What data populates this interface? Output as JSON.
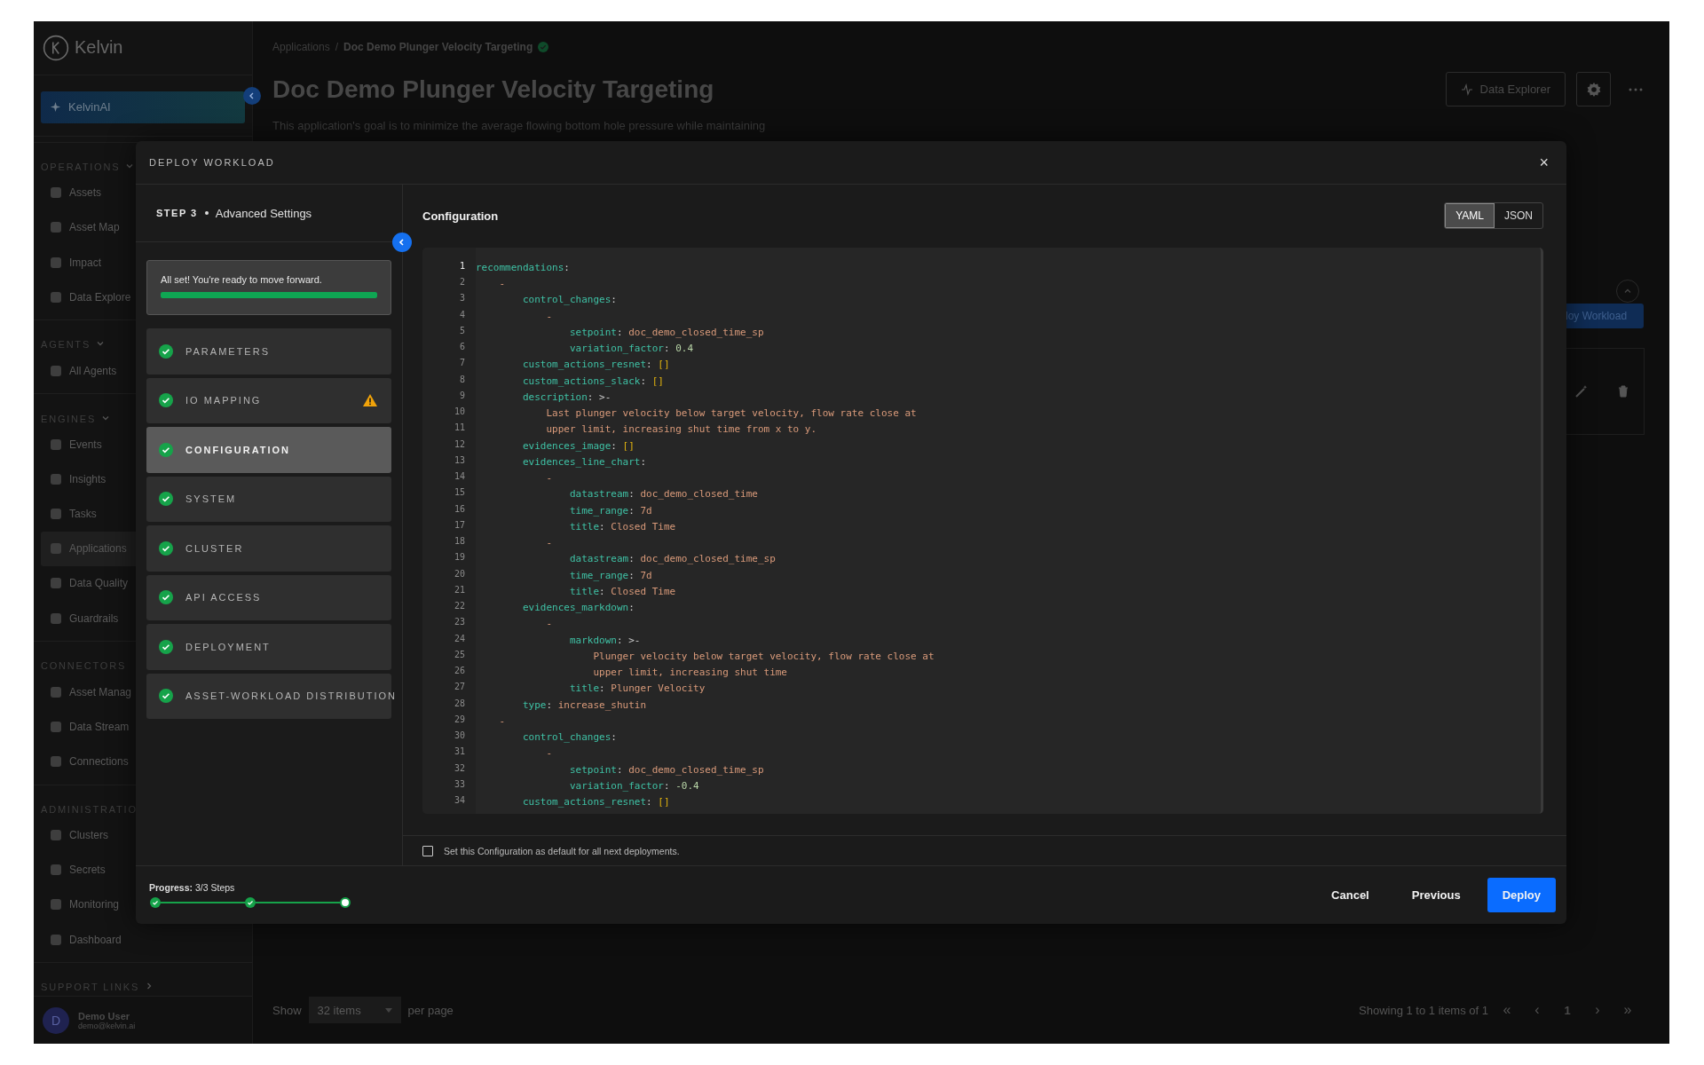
{
  "sidebar": {
    "logo": "Kelvin",
    "ai_button": "KelvinAI",
    "sections": [
      {
        "title": "OPERATIONS",
        "collapsible": true,
        "expanded": true,
        "items": [
          {
            "label": "Assets",
            "selected": false
          },
          {
            "label": "Asset Map",
            "selected": false
          },
          {
            "label": "Impact",
            "selected": false
          },
          {
            "label": "Data Explore",
            "selected": false
          }
        ]
      },
      {
        "title": "AGENTS",
        "collapsible": true,
        "expanded": true,
        "items": [
          {
            "label": "All Agents",
            "selected": false
          }
        ]
      },
      {
        "title": "ENGINES",
        "collapsible": true,
        "expanded": true,
        "items": [
          {
            "label": "Events",
            "selected": false
          },
          {
            "label": "Insights",
            "selected": false
          },
          {
            "label": "Tasks",
            "selected": false
          },
          {
            "label": "Applications",
            "selected": true
          },
          {
            "label": "Data Quality",
            "selected": false
          },
          {
            "label": "Guardrails",
            "selected": false
          }
        ]
      },
      {
        "title": "CONNECTORS",
        "collapsible": false,
        "items": [
          {
            "label": "Asset Manag",
            "selected": false
          },
          {
            "label": "Data Stream",
            "selected": false
          },
          {
            "label": "Connections",
            "selected": false
          }
        ]
      },
      {
        "title": "ADMINISTRATIO",
        "collapsible": false,
        "items": [
          {
            "label": "Clusters",
            "selected": false
          },
          {
            "label": "Secrets",
            "selected": false
          },
          {
            "label": "Monitoring",
            "selected": false
          },
          {
            "label": "Dashboard",
            "selected": false
          }
        ]
      },
      {
        "title": "SUPPORT LINKS",
        "collapsible": true,
        "expanded": false
      }
    ],
    "user": {
      "initial": "D",
      "name": "Demo User",
      "email": "demo@kelvin.ai"
    }
  },
  "page": {
    "breadcrumb": [
      "Applications",
      "Doc Demo Plunger Velocity Targeting"
    ],
    "breadcrumb_separator": "/",
    "title": "Doc Demo Plunger Velocity Targeting",
    "description": "This application's goal is to minimize the average flowing bottom hole pressure while maintaining",
    "data_explorer": "Data Explorer",
    "workload_button": "loy Workload",
    "pagination": {
      "show": "Show",
      "page_size": "32 items",
      "per_page": "per page",
      "summary": "Showing 1 to 1 items of 1",
      "first": "«",
      "prev": "‹",
      "page": "1",
      "next": "›",
      "last": "»"
    }
  },
  "modal": {
    "title": "DEPLOY WORKLOAD",
    "close": "×",
    "step": "STEP 3",
    "step_name": "Advanced Settings",
    "ready": {
      "text": "All set! You're ready to move forward.",
      "level": 1
    },
    "steps": [
      {
        "label": "PARAMETERS",
        "done": true,
        "warning": false,
        "selected": false
      },
      {
        "label": "IO MAPPING",
        "done": true,
        "warning": true,
        "selected": false
      },
      {
        "label": "CONFIGURATION",
        "done": true,
        "warning": false,
        "selected": true
      },
      {
        "label": "SYSTEM",
        "done": true,
        "warning": false,
        "selected": false
      },
      {
        "label": "CLUSTER",
        "done": true,
        "warning": false,
        "selected": false
      },
      {
        "label": "API ACCESS",
        "done": true,
        "warning": false,
        "selected": false
      },
      {
        "label": "DEPLOYMENT",
        "done": true,
        "warning": false,
        "selected": false
      },
      {
        "label": "ASSET-WORKLOAD DISTRIBUTION",
        "done": true,
        "warning": false,
        "selected": false
      }
    ],
    "config_title": "Configuration",
    "formats": [
      {
        "label": "YAML",
        "selected": true
      },
      {
        "label": "JSON",
        "selected": false
      }
    ],
    "code": [
      {
        "n": "1",
        "current": true,
        "tokens": [
          {
            "kind": "key",
            "text": "recommendations"
          },
          {
            "kind": "punct",
            "text": ":"
          }
        ]
      },
      {
        "n": "2",
        "current": false,
        "tokens": [
          {
            "kind": "dash",
            "text": "    -"
          }
        ]
      },
      {
        "n": "3",
        "current": false,
        "tokens": [
          {
            "kind": "key",
            "text": "        control_changes"
          },
          {
            "kind": "punct",
            "text": ":"
          }
        ]
      },
      {
        "n": "4",
        "current": false,
        "tokens": [
          {
            "kind": "dash",
            "text": "            -"
          }
        ]
      },
      {
        "n": "5",
        "current": false,
        "tokens": [
          {
            "kind": "key",
            "text": "                setpoint"
          },
          {
            "kind": "punct",
            "text": ": "
          },
          {
            "kind": "str",
            "text": "doc_demo_closed_time_sp"
          }
        ]
      },
      {
        "n": "6",
        "current": false,
        "tokens": [
          {
            "kind": "key",
            "text": "                variation_factor"
          },
          {
            "kind": "punct",
            "text": ": "
          },
          {
            "kind": "num",
            "text": "0.4"
          }
        ]
      },
      {
        "n": "7",
        "current": false,
        "tokens": [
          {
            "kind": "key",
            "text": "        custom_actions_resnet"
          },
          {
            "kind": "punct",
            "text": ": "
          },
          {
            "kind": "bracket",
            "text": "[]"
          }
        ]
      },
      {
        "n": "8",
        "current": false,
        "tokens": [
          {
            "kind": "key",
            "text": "        custom_actions_slack"
          },
          {
            "kind": "punct",
            "text": ": "
          },
          {
            "kind": "bracket",
            "text": "[]"
          }
        ]
      },
      {
        "n": "9",
        "current": false,
        "tokens": [
          {
            "kind": "key",
            "text": "        description"
          },
          {
            "kind": "punct",
            "text": ": >-"
          }
        ]
      },
      {
        "n": "10",
        "current": false,
        "tokens": [
          {
            "kind": "str",
            "text": "            Last plunger velocity below target velocity, flow rate close at"
          }
        ]
      },
      {
        "n": "11",
        "current": false,
        "tokens": [
          {
            "kind": "str",
            "text": "            upper limit, increasing shut time from x to y."
          }
        ]
      },
      {
        "n": "12",
        "current": false,
        "tokens": [
          {
            "kind": "key",
            "text": "        evidences_image"
          },
          {
            "kind": "punct",
            "text": ": "
          },
          {
            "kind": "bracket",
            "text": "[]"
          }
        ]
      },
      {
        "n": "13",
        "current": false,
        "tokens": [
          {
            "kind": "key",
            "text": "        evidences_line_chart"
          },
          {
            "kind": "punct",
            "text": ":"
          }
        ]
      },
      {
        "n": "14",
        "current": false,
        "tokens": [
          {
            "kind": "dash",
            "text": "            -"
          }
        ]
      },
      {
        "n": "15",
        "current": false,
        "tokens": [
          {
            "kind": "key",
            "text": "                datastream"
          },
          {
            "kind": "punct",
            "text": ": "
          },
          {
            "kind": "str",
            "text": "doc_demo_closed_time"
          }
        ]
      },
      {
        "n": "16",
        "current": false,
        "tokens": [
          {
            "kind": "key",
            "text": "                time_range"
          },
          {
            "kind": "punct",
            "text": ": "
          },
          {
            "kind": "str",
            "text": "7d"
          }
        ]
      },
      {
        "n": "17",
        "current": false,
        "tokens": [
          {
            "kind": "key",
            "text": "                title"
          },
          {
            "kind": "punct",
            "text": ": "
          },
          {
            "kind": "str",
            "text": "Closed Time"
          }
        ]
      },
      {
        "n": "18",
        "current": false,
        "tokens": [
          {
            "kind": "dash",
            "text": "            -"
          }
        ]
      },
      {
        "n": "19",
        "current": false,
        "tokens": [
          {
            "kind": "key",
            "text": "                datastream"
          },
          {
            "kind": "punct",
            "text": ": "
          },
          {
            "kind": "str",
            "text": "doc_demo_closed_time_sp"
          }
        ]
      },
      {
        "n": "20",
        "current": false,
        "tokens": [
          {
            "kind": "key",
            "text": "                time_range"
          },
          {
            "kind": "punct",
            "text": ": "
          },
          {
            "kind": "str",
            "text": "7d"
          }
        ]
      },
      {
        "n": "21",
        "current": false,
        "tokens": [
          {
            "kind": "key",
            "text": "                title"
          },
          {
            "kind": "punct",
            "text": ": "
          },
          {
            "kind": "str",
            "text": "Closed Time"
          }
        ]
      },
      {
        "n": "22",
        "current": false,
        "tokens": [
          {
            "kind": "key",
            "text": "        evidences_markdown"
          },
          {
            "kind": "punct",
            "text": ":"
          }
        ]
      },
      {
        "n": "23",
        "current": false,
        "tokens": [
          {
            "kind": "dash",
            "text": "            -"
          }
        ]
      },
      {
        "n": "24",
        "current": false,
        "tokens": [
          {
            "kind": "key",
            "text": "                markdown"
          },
          {
            "kind": "punct",
            "text": ": >-"
          }
        ]
      },
      {
        "n": "25",
        "current": false,
        "tokens": [
          {
            "kind": "str",
            "text": "                    Plunger velocity below target velocity, flow rate close at"
          }
        ]
      },
      {
        "n": "26",
        "current": false,
        "tokens": [
          {
            "kind": "str",
            "text": "                    upper limit, increasing shut time"
          }
        ]
      },
      {
        "n": "27",
        "current": false,
        "tokens": [
          {
            "kind": "key",
            "text": "                title"
          },
          {
            "kind": "punct",
            "text": ": "
          },
          {
            "kind": "str",
            "text": "Plunger Velocity"
          }
        ]
      },
      {
        "n": "28",
        "current": false,
        "tokens": [
          {
            "kind": "key",
            "text": "        type"
          },
          {
            "kind": "punct",
            "text": ": "
          },
          {
            "kind": "str",
            "text": "increase_shutin"
          }
        ]
      },
      {
        "n": "29",
        "current": false,
        "tokens": [
          {
            "kind": "dash",
            "text": "    -"
          }
        ]
      },
      {
        "n": "30",
        "current": false,
        "tokens": [
          {
            "kind": "key",
            "text": "        control_changes"
          },
          {
            "kind": "punct",
            "text": ":"
          }
        ]
      },
      {
        "n": "31",
        "current": false,
        "tokens": [
          {
            "kind": "dash",
            "text": "            -"
          }
        ]
      },
      {
        "n": "32",
        "current": false,
        "tokens": [
          {
            "kind": "key",
            "text": "                setpoint"
          },
          {
            "kind": "punct",
            "text": ": "
          },
          {
            "kind": "str",
            "text": "doc_demo_closed_time_sp"
          }
        ]
      },
      {
        "n": "33",
        "current": false,
        "tokens": [
          {
            "kind": "key",
            "text": "                variation_factor"
          },
          {
            "kind": "punct",
            "text": ": "
          },
          {
            "kind": "num",
            "text": "-0.4"
          }
        ]
      },
      {
        "n": "34",
        "current": false,
        "tokens": [
          {
            "kind": "key",
            "text": "        custom_actions_resnet"
          },
          {
            "kind": "punct",
            "text": ": "
          },
          {
            "kind": "bracket",
            "text": "[]"
          }
        ]
      }
    ],
    "default_checkbox": {
      "label": "Set this Configuration as default for all next deployments.",
      "checked": false
    },
    "progress": {
      "label": "**Progress:** 3/3 Steps",
      "steps": [
        {
          "done": true
        },
        {
          "done": true
        },
        {
          "done": false
        }
      ]
    },
    "buttons": [
      {
        "label": "Cancel",
        "kind": "plain"
      },
      {
        "label": "Previous",
        "kind": "plain"
      },
      {
        "label": "Deploy",
        "kind": "primary"
      }
    ]
  }
}
